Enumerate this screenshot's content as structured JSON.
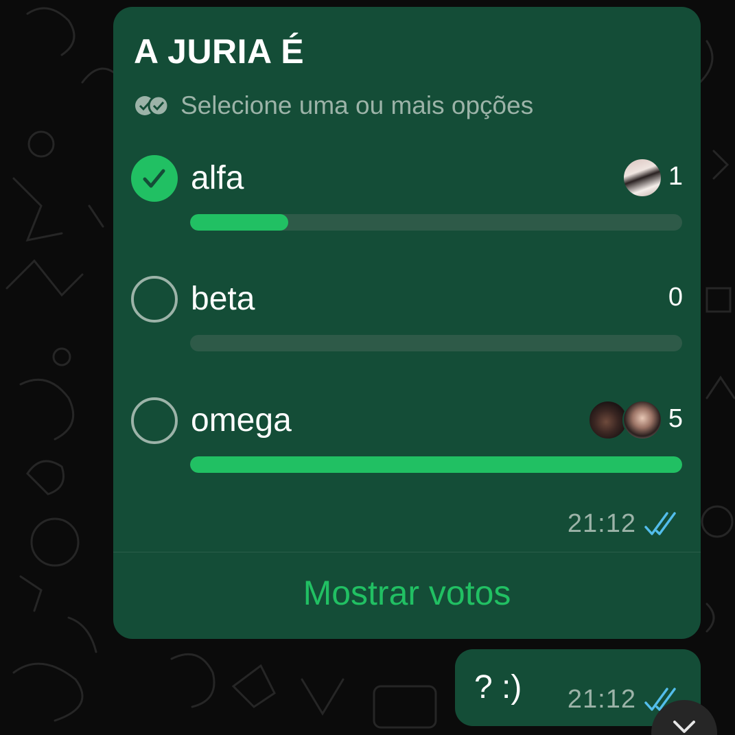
{
  "poll": {
    "title": "A JURIA É",
    "subtitle": "Selecione uma ou mais opções",
    "subtitle_icon": "double-check-circles-icon",
    "options": [
      {
        "label": "alfa",
        "count": "1",
        "selected": true,
        "progress": 0.2
      },
      {
        "label": "beta",
        "count": "0",
        "selected": false,
        "progress": 0.0
      },
      {
        "label": "omega",
        "count": "5",
        "selected": false,
        "progress": 1.0
      }
    ],
    "time": "21:12",
    "status_icon": "double-check-read-icon",
    "show_votes_label": "Mostrar votos"
  },
  "message": {
    "text": "? :)",
    "time": "21:12",
    "status_icon": "double-check-read-icon"
  },
  "scroll_button_icon": "chevron-down-icon",
  "colors": {
    "background": "#0b0b0b",
    "bubble": "#144d37",
    "accent": "#21c063",
    "bar_track": "#2e5a48",
    "meta_text": "#9cb3a8",
    "read_ticks": "#53bdeb"
  }
}
